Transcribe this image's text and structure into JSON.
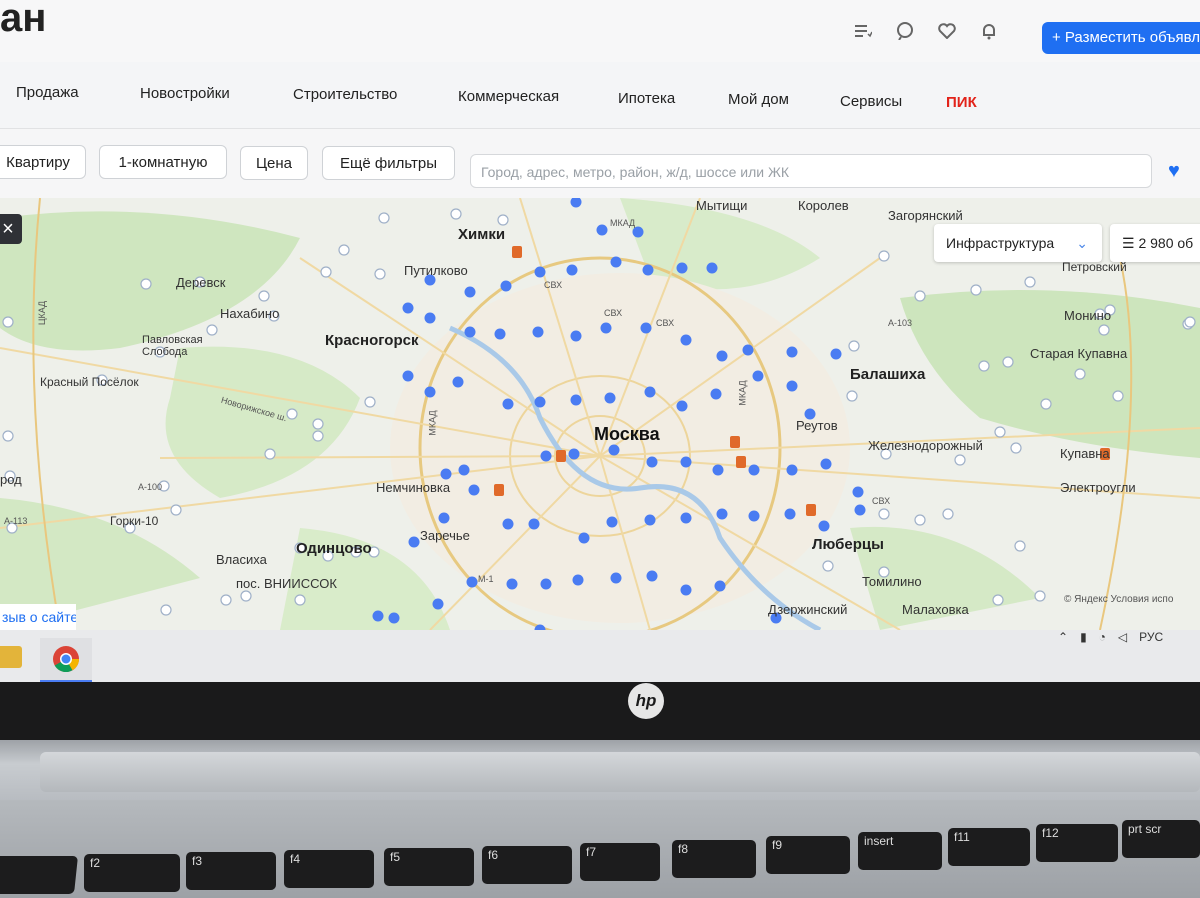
{
  "header": {
    "logo": "ан",
    "post_button": "+ Разместить объявл"
  },
  "icons": {
    "list": "list-icon",
    "chat": "chat-icon",
    "favorite": "heart-icon",
    "notifications": "bell-icon"
  },
  "nav": {
    "items": [
      "Продажа",
      "Новостройки",
      "Строительство",
      "Коммерческая",
      "Ипотека",
      "Мой дом",
      "Сервисы",
      "ПИК"
    ]
  },
  "filters": {
    "type": "Квартиру",
    "rooms": "1-комнатную",
    "price": "Цена",
    "more": "Ещё фильтры",
    "search_placeholder": "Город, адрес, метро, район, ж/д, шоссе или ЖК"
  },
  "map": {
    "infrastructure": "Инфраструктура",
    "count": "2 980 об",
    "feedback": "зыв о сайте",
    "copyright": "© Яндекс Условия испо",
    "labels": [
      "Мытищи",
      "Королев",
      "Загорянский",
      "Химки",
      "Путилково",
      "Деревск",
      "Нахабино",
      "Павловская Слобода",
      "Красногорск",
      "Красный Посёлок",
      "Новорижское ш.",
      "Москва",
      "Реутов",
      "Балашиха",
      "Железнодорожный",
      "Старая Купавна",
      "Монино",
      "Петровский",
      "Купавна",
      "Электроугли",
      "Немчиновка",
      "Заречье",
      "Одинцово",
      "Горки-10",
      "Власиха",
      "пос. ВНИИССОК",
      "Люберцы",
      "Томилино",
      "Дзержинский",
      "Малаховка",
      "род"
    ],
    "road_labels": [
      "СВХ",
      "СВХ",
      "СВХ",
      "МКАД",
      "МКАД",
      "МКАД",
      "ЦКАД",
      "А-103",
      "А-113",
      "А-100",
      "М-1",
      "СВХ"
    ]
  },
  "tray": {
    "language": "РУС"
  },
  "laptop": {
    "brand": "hp",
    "keys": [
      "",
      "f2",
      "f3",
      "f4",
      "f5",
      "f6",
      "f7",
      "f8",
      "f9",
      "insert",
      "f11",
      "f12",
      "prt scr"
    ]
  }
}
